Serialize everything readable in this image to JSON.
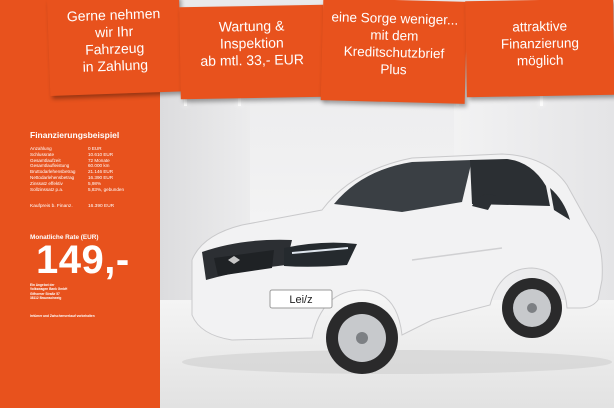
{
  "banners": [
    {
      "text": "Gerne nehmen\nwir Ihr\nFahrzeug\nin Zahlung"
    },
    {
      "text": "Wartung &\nInspektion\nab mtl. 33,- EUR"
    },
    {
      "text": "eine Sorge weniger...\nmit dem\nKreditschutzbrief\nPlus"
    },
    {
      "text": "attraktive\nFinanzierung\nmöglich"
    }
  ],
  "financing": {
    "title": "Finanzierungsbeispiel",
    "rows": [
      {
        "label": "Anzahlung",
        "value": "0 EUR"
      },
      {
        "label": "Schlussrate",
        "value": "10.610 EUR"
      },
      {
        "label": "Gesamtlaufzeit",
        "value": "72 Monate"
      },
      {
        "label": "Gesamtlaufleistung",
        "value": "60.000 km"
      },
      {
        "label": "Bruttodarlehensbetrag",
        "value": "21.146 EUR"
      },
      {
        "label": "Nettodarlehensbetrag",
        "value": "16.390 EUR"
      },
      {
        "label": "Zinssatz effektiv",
        "value": "5,98%"
      },
      {
        "label": "Sollzinssatz p.a.",
        "value": "5,83%, gebunden"
      }
    ],
    "purchase_label": "Kaufpreis b. Finanz.",
    "purchase_value": "16.390 EUR",
    "rate_label": "Monatliche Rate (EUR)",
    "rate_value": "149,-",
    "provider_lines": [
      "Ein Angebot der",
      "Volkswagen Bank GmbH",
      "Gifhorner Straße 57",
      "38112 Braunschweig"
    ],
    "note": "Irrtümer und Zwischenverkauf vorbehalten"
  },
  "car": {
    "plate_text": "Lei/z",
    "colors": {
      "body": "#f3f3f4",
      "window": "#2b2f33",
      "accent": "#e8521d"
    }
  },
  "colors": {
    "brand_orange": "#e8521d",
    "text_on_orange": "#ffffff"
  }
}
